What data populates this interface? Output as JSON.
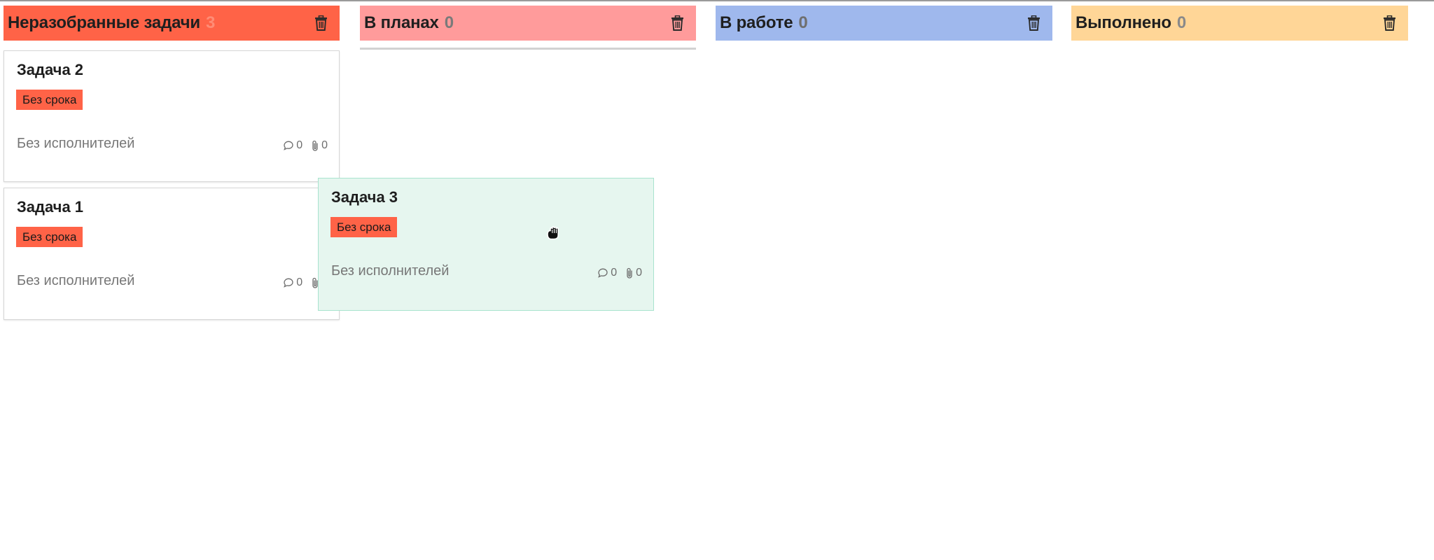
{
  "columns": [
    {
      "title": "Неразобранные задачи",
      "count": "3",
      "color": "#ff6347",
      "count_color": "#ff8c75"
    },
    {
      "title": "В планах",
      "count": "0",
      "color": "#ff9b9b",
      "count_color": "#7a7a7a"
    },
    {
      "title": "В работе",
      "count": "0",
      "color": "#9fb8ed",
      "count_color": "#6f6f6f"
    },
    {
      "title": "Выполнено",
      "count": "0",
      "color": "#ffd697",
      "count_color": "#8a8a8a"
    }
  ],
  "cards": [
    {
      "title": "Задача 2",
      "badge": "Без срока",
      "badge_color": "#ff6347",
      "assignees": "Без исполнителей",
      "comments": "0",
      "attachments": "0"
    },
    {
      "title": "Задача 1",
      "badge": "Без срока",
      "badge_color": "#ff6347",
      "assignees": "Без исполнителей",
      "comments": "0",
      "attachments": "0"
    },
    {
      "title": "Задача 3",
      "badge": "Без срока",
      "badge_color": "#ff6347",
      "assignees": "Без исполнителей",
      "comments": "0",
      "attachments": "0",
      "state": "dragging"
    }
  ],
  "icons": {
    "delete": "trash-icon",
    "comments": "comment-bubble-icon",
    "attachments": "paperclip-icon",
    "cursor": "grab-hand-icon"
  }
}
